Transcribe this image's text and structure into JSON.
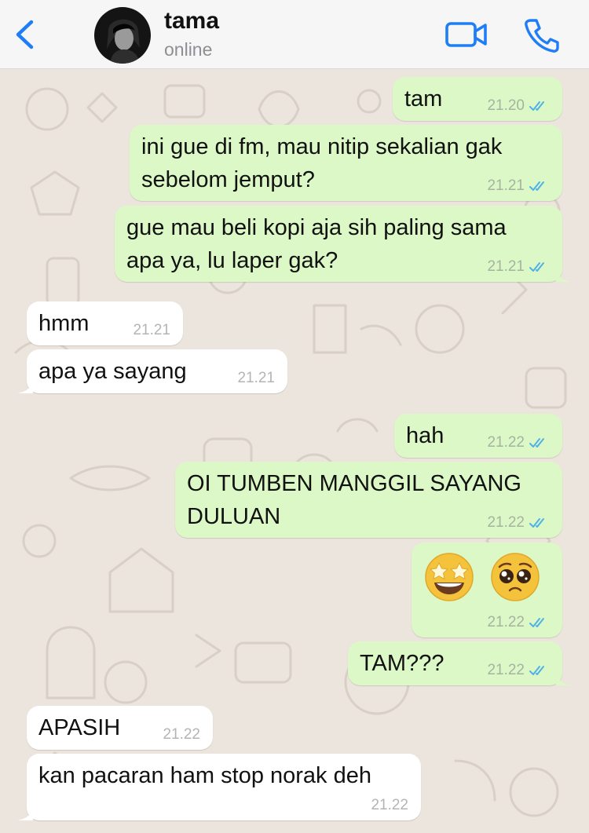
{
  "header": {
    "contact_name": "tama",
    "status": "online"
  },
  "colors": {
    "accent": "#1f7ef6",
    "outgoing_bubble": "#dcf8c6",
    "incoming_bubble": "#ffffff",
    "chat_background": "#ece5dd",
    "read_ticks": "#4fb2e7"
  },
  "icons": {
    "back": "chevron-left-icon",
    "video": "video-camera-icon",
    "call": "phone-icon",
    "read_receipt": "double-check-icon"
  },
  "messages": [
    {
      "direction": "out",
      "text": "tam",
      "time": "21.20",
      "read": true
    },
    {
      "direction": "out",
      "lines": [
        "ini gue di fm, mau nitip sekalian gak",
        "sebelom jemput?"
      ],
      "time": "21.21",
      "read": true
    },
    {
      "direction": "out",
      "lines": [
        "gue mau beli kopi aja sih paling sama",
        "apa ya, lu laper gak?"
      ],
      "time": "21.21",
      "read": true
    },
    {
      "direction": "in",
      "text": "hmm",
      "time": "21.21"
    },
    {
      "direction": "in",
      "text": "apa ya sayang",
      "time": "21.21"
    },
    {
      "direction": "out",
      "text": "hah",
      "time": "21.22",
      "read": true
    },
    {
      "direction": "out",
      "lines": [
        "OI TUMBEN MANGGIL SAYANG",
        "DULUAN"
      ],
      "time": "21.22",
      "read": true
    },
    {
      "direction": "out",
      "emojis": [
        "star-struck-emoji",
        "pleading-face-emoji"
      ],
      "time": "21.22",
      "read": true
    },
    {
      "direction": "out",
      "text": "TAM???",
      "time": "21.22",
      "read": true
    },
    {
      "direction": "in",
      "text": "APASIH",
      "time": "21.22"
    },
    {
      "direction": "in",
      "text": "kan pacaran ham stop norak deh",
      "time": "21.22"
    }
  ]
}
